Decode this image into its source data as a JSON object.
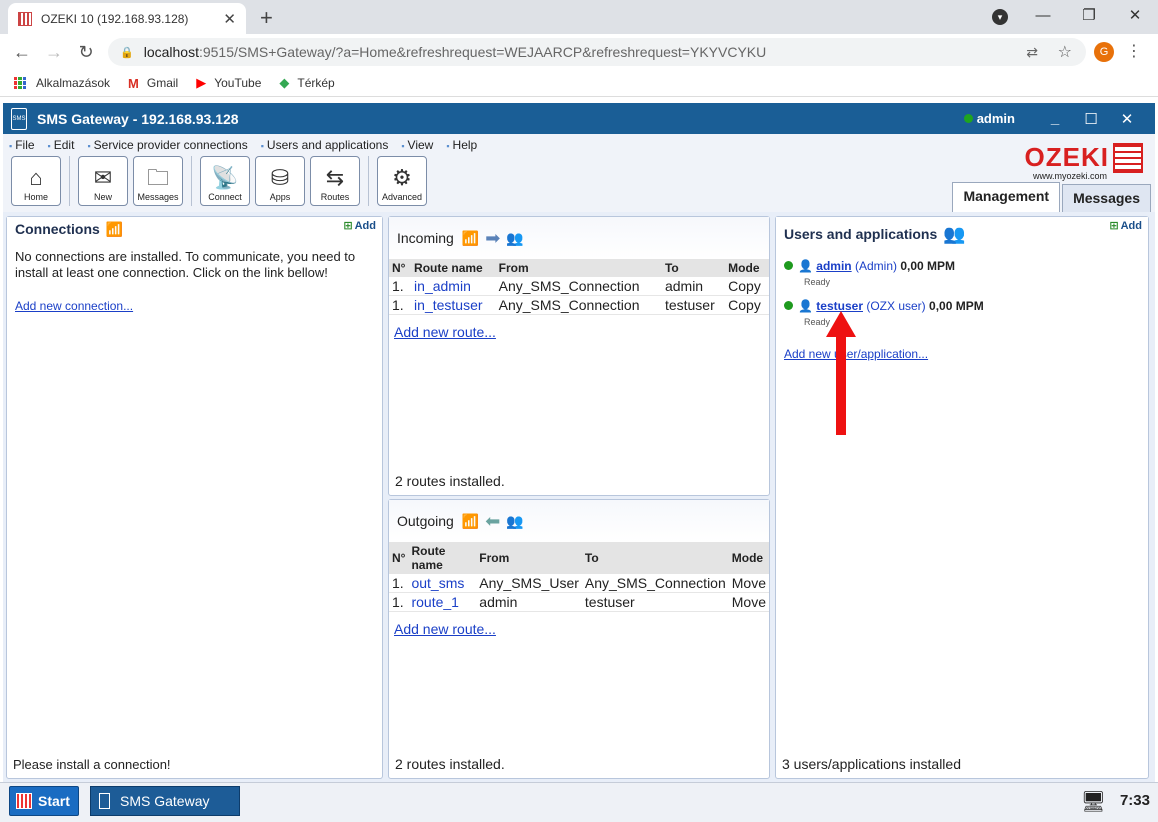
{
  "browser": {
    "tab_title": "OZEKI 10 (192.168.93.128)",
    "url_host": "localhost",
    "url_path": ":9515/SMS+Gateway/?a=Home&refreshrequest=WEJAARCP&refreshrequest=YKYVCYKU",
    "profile_initial": "G",
    "bookmarks": [
      "Alkalmazások",
      "Gmail",
      "YouTube",
      "Térkép"
    ]
  },
  "app": {
    "title": "SMS Gateway - 192.168.93.128",
    "user": "admin",
    "menu": [
      "File",
      "Edit",
      "Service provider connections",
      "Users and applications",
      "View",
      "Help"
    ],
    "toolbar": [
      "Home",
      "New",
      "Messages",
      "Connect",
      "Apps",
      "Routes",
      "Advanced"
    ],
    "logo_text": "OZEKI",
    "logo_url": "www.myozeki.com",
    "tabs": [
      "Management",
      "Messages"
    ]
  },
  "connections": {
    "title": "Connections",
    "add": "Add",
    "message": "No connections are installed. To communicate, you need to install at least one connection. Click on the link bellow!",
    "link": "Add new connection...",
    "footer": "Please install a connection!"
  },
  "incoming": {
    "title": "Incoming",
    "headers": [
      "N°",
      "Route name",
      "From",
      "To",
      "Mode"
    ],
    "rows": [
      {
        "n": "1.",
        "name": "in_admin",
        "from": "Any_SMS_Connection",
        "to": "admin",
        "mode": "Copy"
      },
      {
        "n": "1.",
        "name": "in_testuser",
        "from": "Any_SMS_Connection",
        "to": "testuser",
        "mode": "Copy"
      }
    ],
    "link": "Add new route...",
    "footer": "2 routes installed."
  },
  "outgoing": {
    "title": "Outgoing",
    "headers": [
      "N°",
      "Route name",
      "From",
      "To",
      "Mode"
    ],
    "rows": [
      {
        "n": "1.",
        "name": "out_sms",
        "from": "Any_SMS_User",
        "to": "Any_SMS_Connection",
        "mode": "Move"
      },
      {
        "n": "1.",
        "name": "route_1",
        "from": "admin",
        "to": "testuser",
        "mode": "Move"
      }
    ],
    "link": "Add new route...",
    "footer": "2 routes installed."
  },
  "users": {
    "title": "Users and applications",
    "add": "Add",
    "list": [
      {
        "name": "admin",
        "type": "(Admin)",
        "rate": "0,00 MPM",
        "status": "Ready"
      },
      {
        "name": "testuser",
        "type": "(OZX user)",
        "rate": "0,00 MPM",
        "status": "Ready"
      }
    ],
    "link": "Add new user/application...",
    "footer": "3 users/applications installed"
  },
  "taskbar": {
    "start": "Start",
    "app": "SMS Gateway",
    "time": "7:33"
  },
  "colors": {
    "accent": "#1a5e96",
    "arrow": "#ee1111",
    "online": "#1e9a1e"
  }
}
